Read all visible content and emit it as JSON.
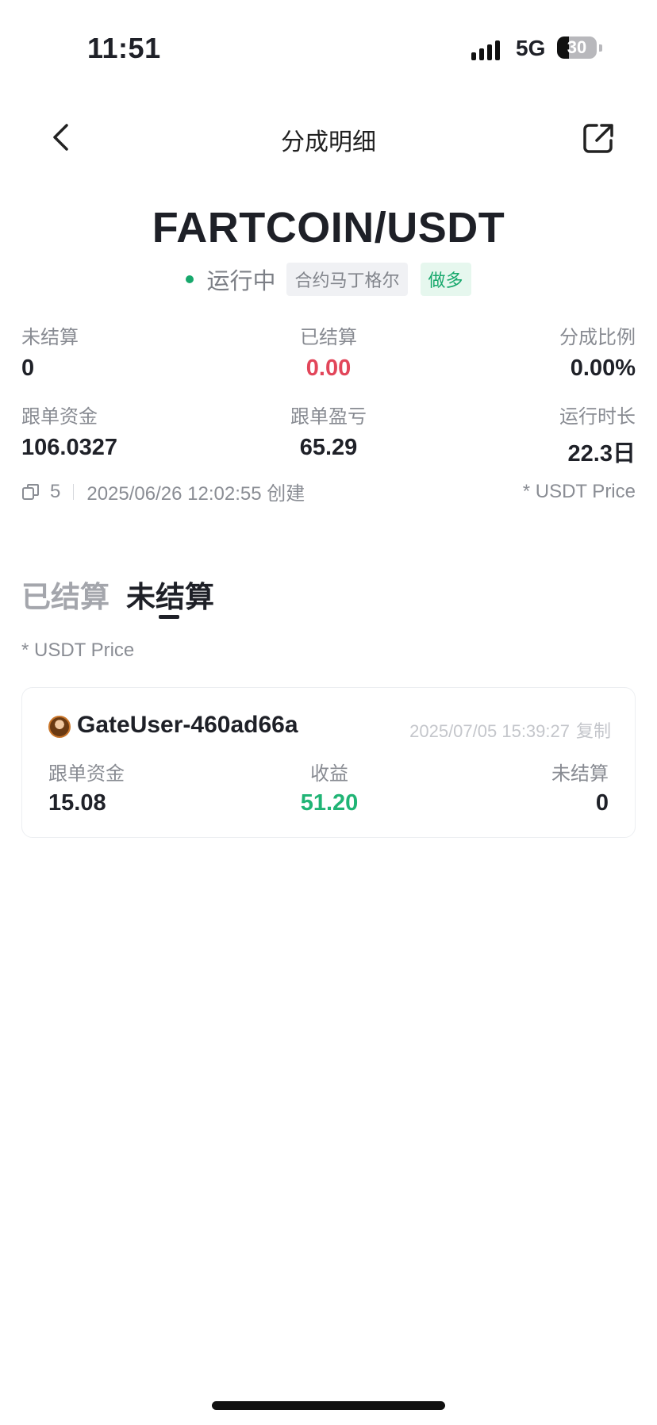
{
  "status_bar": {
    "time": "11:51",
    "network": "5G",
    "battery": "30",
    "battery_level": 0.3
  },
  "nav": {
    "title": "分成明细",
    "back_icon": "chevron-left-icon",
    "share_icon": "share-external-icon"
  },
  "header": {
    "pair": "FARTCOIN/USDT",
    "status": "运行中",
    "strategy_tag": "合约马丁格尔",
    "direction_tag": "做多"
  },
  "stats": [
    {
      "label": "未结算",
      "value": "0"
    },
    {
      "label": "已结算",
      "value": "0.00"
    },
    {
      "label": "分成比例",
      "value": "0.00%"
    },
    {
      "label": "跟单资金",
      "value": "106.0327"
    },
    {
      "label": "跟单盈亏",
      "value": "65.29"
    },
    {
      "label": "运行时长",
      "value": "22.3日"
    }
  ],
  "meta": {
    "copy_count": "5",
    "created": "2025/06/26 12:02:55 创建",
    "price_note": "* USDT Price"
  },
  "tabs": [
    {
      "label": "已结算",
      "active": false
    },
    {
      "label": "未结算",
      "active": true
    }
  ],
  "list_note": "* USDT Price",
  "records": [
    {
      "user": "GateUser-460ad66a",
      "time": "2025/07/05 15:39:27",
      "copy_label": "复制",
      "fund_label": "跟单资金",
      "fund": "15.08",
      "profit_label": "收益",
      "profit": "51.20",
      "unsettled_label": "未结算",
      "unsettled": "0"
    }
  ],
  "colors": {
    "accent_green": "#17a86c",
    "red": "#e2465a",
    "profit_green": "#20b475"
  }
}
